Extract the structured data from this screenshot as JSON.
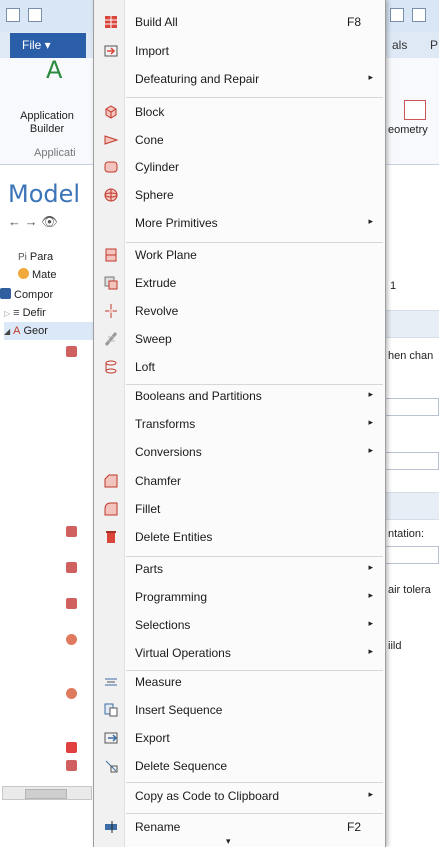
{
  "background": {
    "file_tab": "File ▾",
    "tab_fragments": [
      "als",
      "P"
    ],
    "application_builder": "Application\nBuilder",
    "group_label": "Applicati",
    "geometry_fragment": "eometry",
    "model_title": "Model",
    "tree": [
      {
        "label": "Para",
        "icon": "param-icon"
      },
      {
        "label": "Mate",
        "icon": "material-icon"
      },
      {
        "label": "Compor",
        "icon": "component-icon"
      },
      {
        "label": "Defir",
        "icon": "definitions-icon"
      },
      {
        "label": "Geor",
        "icon": "geometry-icon"
      }
    ],
    "right_fragments": [
      "1",
      "hen chan",
      "ntation:",
      "air tolera",
      "iild"
    ],
    "param_prefix": "Pi"
  },
  "menu": {
    "items": [
      {
        "label": "Build All",
        "shortcut": "F8",
        "icon": "build-all-icon"
      },
      {
        "label": "Import",
        "icon": "import-icon"
      },
      {
        "label": "Defeaturing and Repair",
        "submenu": true
      },
      {
        "label": "Block",
        "icon": "block-icon"
      },
      {
        "label": "Cone",
        "icon": "cone-icon"
      },
      {
        "label": "Cylinder",
        "icon": "cylinder-icon"
      },
      {
        "label": "Sphere",
        "icon": "sphere-icon"
      },
      {
        "label": "More Primitives",
        "submenu": true
      },
      {
        "label": "Work Plane",
        "icon": "work-plane-icon"
      },
      {
        "label": "Extrude",
        "icon": "extrude-icon"
      },
      {
        "label": "Revolve",
        "icon": "revolve-icon"
      },
      {
        "label": "Sweep",
        "icon": "sweep-icon"
      },
      {
        "label": "Loft",
        "icon": "loft-icon"
      },
      {
        "label": "Booleans and Partitions",
        "submenu": true
      },
      {
        "label": "Transforms",
        "submenu": true
      },
      {
        "label": "Conversions",
        "submenu": true
      },
      {
        "label": "Chamfer",
        "icon": "chamfer-icon"
      },
      {
        "label": "Fillet",
        "icon": "fillet-icon"
      },
      {
        "label": "Delete Entities",
        "icon": "delete-entities-icon"
      },
      {
        "label": "Parts",
        "submenu": true
      },
      {
        "label": "Programming",
        "submenu": true
      },
      {
        "label": "Selections",
        "submenu": true
      },
      {
        "label": "Virtual Operations",
        "submenu": true
      },
      {
        "label": "Measure",
        "icon": "measure-icon"
      },
      {
        "label": "Insert Sequence",
        "icon": "insert-sequence-icon"
      },
      {
        "label": "Export",
        "icon": "export-icon"
      },
      {
        "label": "Delete Sequence",
        "icon": "delete-sequence-icon"
      },
      {
        "label": "Copy as Code to Clipboard",
        "submenu": true
      },
      {
        "label": "Rename",
        "shortcut": "F2",
        "icon": "rename-icon"
      }
    ],
    "submenu_glyph": "▸",
    "scroll_glyph": "▾"
  },
  "colors": {
    "accent_red": "#c0392b",
    "menu_bg": "#fbfbfb",
    "file_tab": "#2a5ea8",
    "model_title": "#3c74b8"
  }
}
